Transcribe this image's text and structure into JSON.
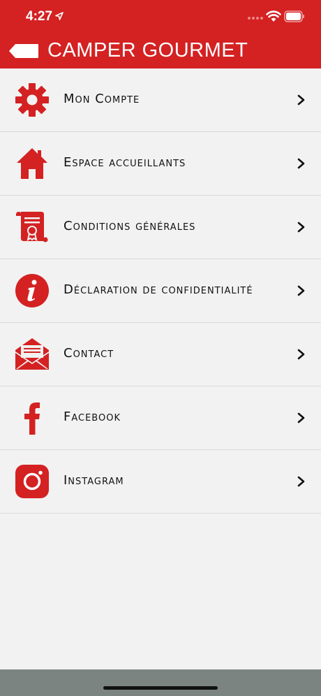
{
  "status": {
    "time": "4:27"
  },
  "header": {
    "title": "CAMPER GOURMET"
  },
  "menu": {
    "items": [
      {
        "label": "Mon Compte",
        "icon": "gear-icon"
      },
      {
        "label": "Espace accueillants",
        "icon": "home-icon"
      },
      {
        "label": "Conditions générales",
        "icon": "document-certificate-icon"
      },
      {
        "label": "Déclaration de confidentialité",
        "icon": "info-icon"
      },
      {
        "label": "Contact",
        "icon": "envelope-icon"
      },
      {
        "label": "Facebook",
        "icon": "facebook-icon"
      },
      {
        "label": "Instagram",
        "icon": "instagram-icon"
      }
    ]
  },
  "colors": {
    "accent": "#d42122",
    "background": "#f2f2f2",
    "bottom_bar": "#7c8482"
  }
}
